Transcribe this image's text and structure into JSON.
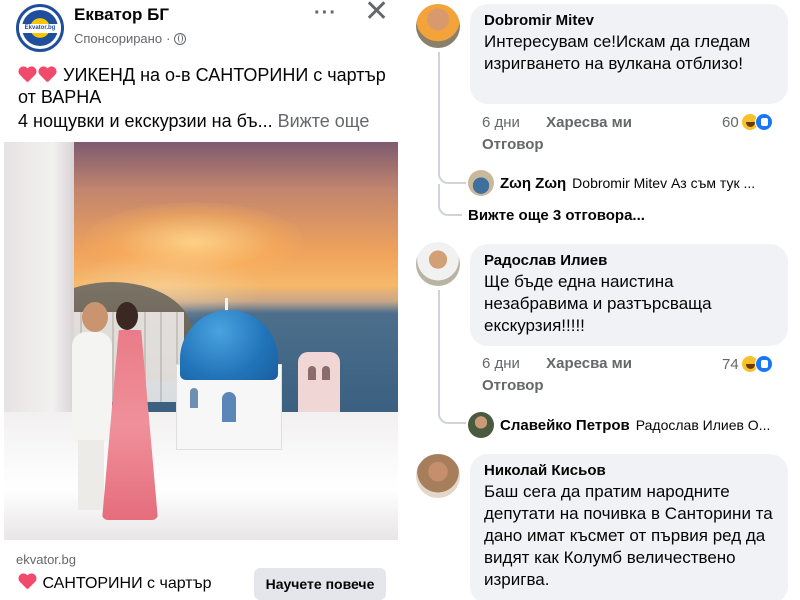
{
  "post": {
    "page_name": "Екватор БГ",
    "logo_text": "Ekvator.bg",
    "sponsored": "Спонсорирано",
    "dot_sep": "·",
    "more_icon": "···",
    "close_icon": "✕",
    "line1": "УИКЕНД на о-в САНТОРИНИ с чартър от ВАРНА",
    "line3": "4 нощувки и екскурзии на бъ...",
    "see_more": "Вижте още",
    "link_domain": "ekvator.bg",
    "link_title": "САНТОРИНИ с чартър",
    "cta": "Научете повече"
  },
  "comments": [
    {
      "name": "Dobromir Mitev",
      "text": "Интересувам се!Искам да гледам изригването на вулкана отблизо!",
      "time": "6 дни",
      "like": "Харесва ми",
      "reply": "Отговор",
      "reactions": "60"
    },
    {
      "name": "Радослав Илиев",
      "text": "Ще бъде една наистина незабравима и разтърсваща екскурзия!!!!!",
      "time": "6 дни",
      "like": "Харесва ми",
      "reply": "Отговор",
      "reactions": "74"
    },
    {
      "name": "Николай Кисьов",
      "text": "Баш сега да пратим народните депутати на почивка в Санторини та дано имат късмет от първия ред да видят как Колумб величествено изригва."
    }
  ],
  "replies": [
    {
      "name": "Ζωη Ζωη",
      "preview": "Dobromir Mitev Аз съм тук ..."
    },
    {
      "name": "Славейко Петров",
      "preview": "Радослав Илиев О..."
    }
  ],
  "more_replies": "Вижте още 3 отговора...",
  "colors": {
    "accent": "#1877f2",
    "bubble": "#f0f2f5",
    "muted": "#65676b",
    "heart": "#f04a6c"
  }
}
